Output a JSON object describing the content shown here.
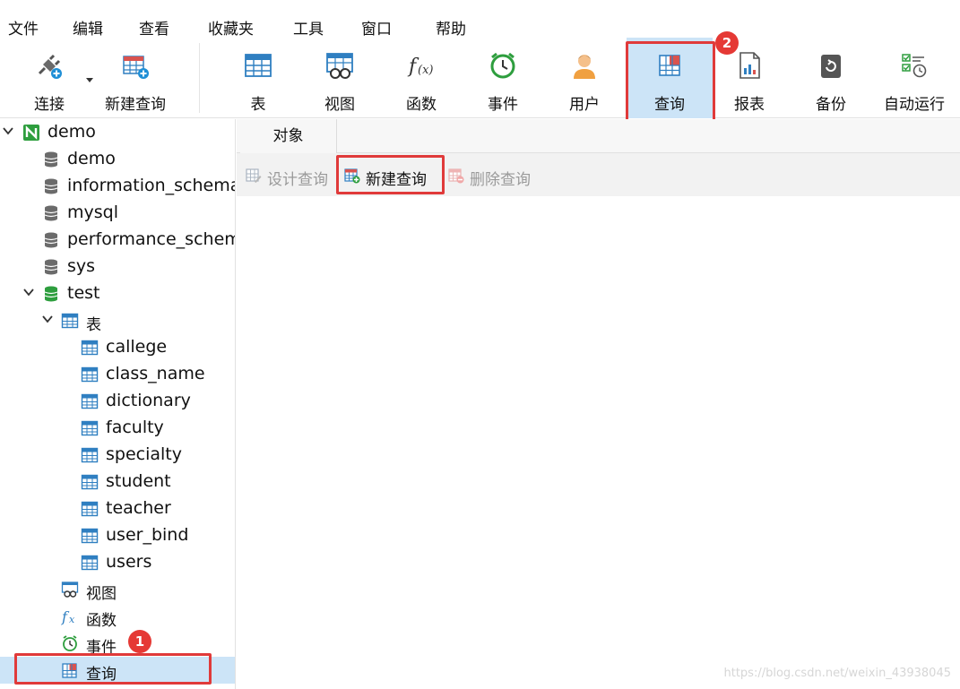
{
  "menu": [
    "文件",
    "编辑",
    "查看",
    "收藏夹",
    "工具",
    "窗口",
    "帮助"
  ],
  "toolbar": {
    "connect": "连接",
    "new_query": "新建查询",
    "table": "表",
    "view": "视图",
    "function": "函数",
    "event": "事件",
    "user": "用户",
    "query": "查询",
    "report": "报表",
    "backup": "备份",
    "autorun": "自动运行"
  },
  "tree": {
    "connection": "demo",
    "databases": [
      "demo",
      "information_schema",
      "mysql",
      "performance_schema",
      "sys"
    ],
    "open_db": "test",
    "tables_label": "表",
    "tables": [
      "callege",
      "class_name",
      "dictionary",
      "faculty",
      "specialty",
      "student",
      "teacher",
      "user_bind",
      "users"
    ],
    "views_label": "视图",
    "functions_label": "函数",
    "events_label": "事件",
    "queries_label": "查询"
  },
  "tab": {
    "objects": "对象"
  },
  "object_toolbar": {
    "design_query": "设计查询",
    "new_query": "新建查询",
    "delete_query": "删除查询"
  },
  "badges": {
    "step1": "1",
    "step2": "2"
  },
  "watermark": "https://blog.csdn.net/weixin_43938045",
  "colors": {
    "highlight": "#e03a3a",
    "selected": "#cce4f7",
    "db_open": "#2e9e3e",
    "db_icon": "#6b6b6b",
    "table_icon": "#2f7fc1"
  }
}
